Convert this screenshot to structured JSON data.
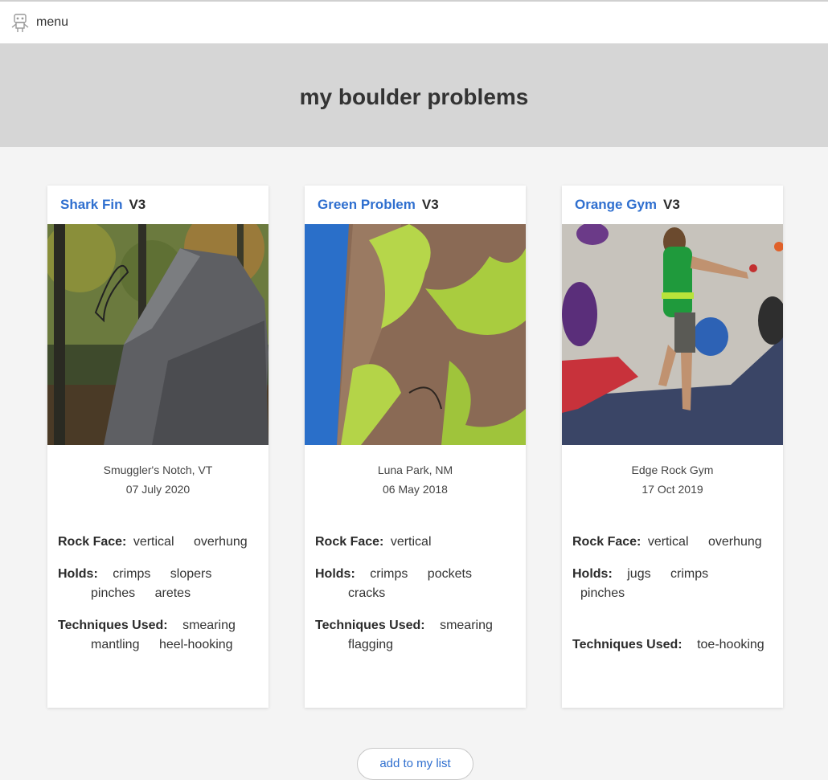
{
  "app": {
    "menu_label": "menu",
    "page_title": "my boulder problems",
    "accent_color": "#2f6fcf"
  },
  "cards": [
    {
      "name": "Shark Fin",
      "grade": "V3",
      "location": "Smuggler's Notch, VT",
      "date": "07 July 2020",
      "rock_face_label": "Rock Face:",
      "rock_face": [
        "vertical",
        "overhung"
      ],
      "holds_label": "Holds:",
      "holds": [
        "crimps",
        "slopers",
        "pinches",
        "aretes"
      ],
      "techniques_label": "Techniques Used:",
      "techniques": [
        "smearing",
        "mantling",
        "heel-hooking"
      ]
    },
    {
      "name": "Green Problem",
      "grade": "V3",
      "location": "Luna Park, NM",
      "date": "06 May 2018",
      "rock_face_label": "Rock Face:",
      "rock_face": [
        "vertical"
      ],
      "holds_label": "Holds:",
      "holds": [
        "crimps",
        "pockets",
        "cracks"
      ],
      "techniques_label": "Techniques Used:",
      "techniques": [
        "smearing",
        "flagging"
      ]
    },
    {
      "name": "Orange Gym",
      "grade": "V3",
      "location": "Edge Rock Gym",
      "date": "17 Oct 2019",
      "rock_face_label": "Rock Face:",
      "rock_face": [
        "vertical",
        "overhung"
      ],
      "holds_label": "Holds:",
      "holds": [
        "jugs",
        "crimps",
        "pinches"
      ],
      "techniques_label": "Techniques Used:",
      "techniques": [
        "toe-hooking"
      ]
    }
  ],
  "bottom_button_label": "add to my list"
}
